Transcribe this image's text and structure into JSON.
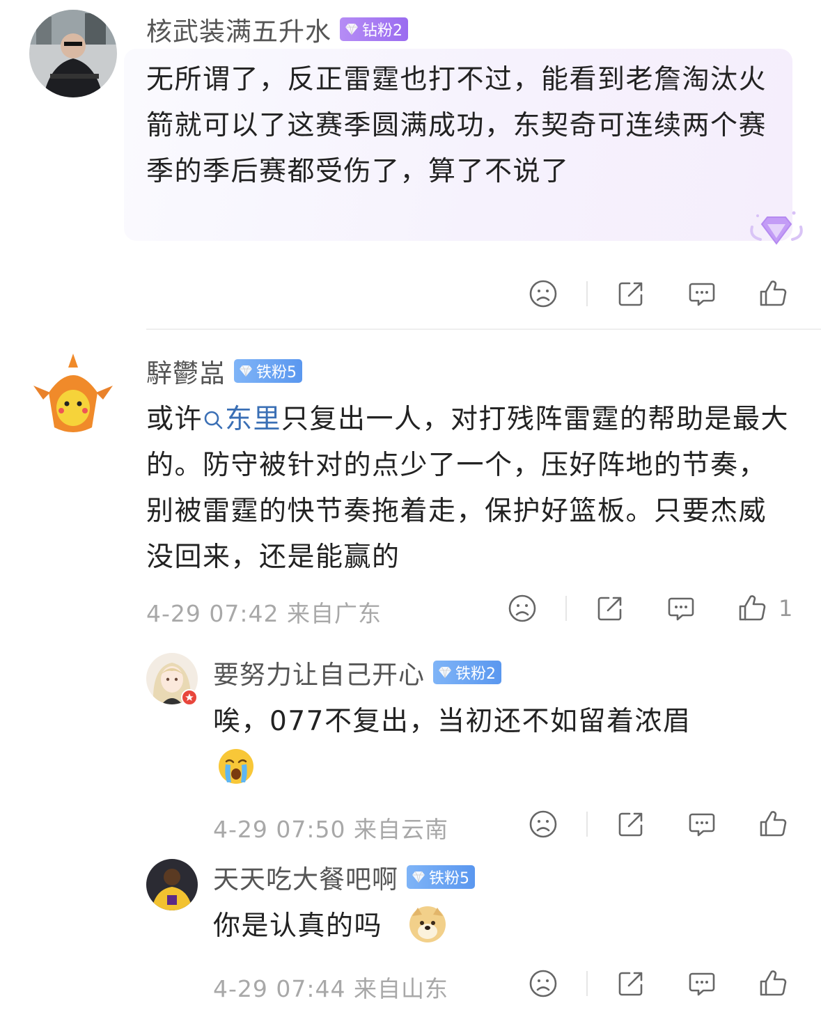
{
  "comments": [
    {
      "username": "核武装满五升水",
      "badge": "钻粉2",
      "text": "无所谓了，反正雷霆也打不过，能看到老詹淘汰火箭就可以了这赛季圆满成功，东契奇可连续两个赛季的季后赛都受伤了，算了不说了"
    },
    {
      "username": "騂鬱嵓",
      "badge": "铁粉5",
      "text_prefix": "或许",
      "text_link": "东里",
      "text_suffix": "只复出一人，对打残阵雷霆的帮助是最大的。防守被针对的点少了一个，压好阵地的节奏，别被雷霆的快节奏拖着走，保护好篮板。只要杰威没回来，还是能赢的",
      "meta": "4-29 07:42 来自广东",
      "like_count": "1"
    }
  ],
  "replies": [
    {
      "username": "要努力让自己开心",
      "badge": "铁粉2",
      "text": "唉，077不复出，当初还不如留着浓眉",
      "meta": "4-29 07:50 来自云南"
    },
    {
      "username": "天天吃大餐吧啊",
      "badge": "铁粉5",
      "text": "你是认真的吗",
      "meta": "4-29 07:44 来自山东"
    }
  ],
  "colors": {
    "badge_diamond": "#a57af2",
    "badge_iron": "#6aa6f3",
    "link": "#3a6fb5",
    "meta": "#a8a8a8"
  },
  "icons": [
    "dislike-icon",
    "share-icon",
    "comment-icon",
    "like-icon",
    "search-link-icon",
    "crying-emoji",
    "doge-emoji",
    "gem-icon"
  ]
}
